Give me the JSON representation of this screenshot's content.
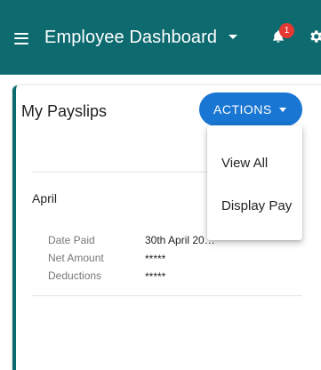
{
  "appbar": {
    "title": "Employee Dashboard",
    "notification_count": "1",
    "background": "#0d6a6f"
  },
  "card": {
    "title": "My Payslips",
    "actions_label": "ACTIONS",
    "accent": "#0d6a6f",
    "button_color": "#1976d2"
  },
  "menu": {
    "items": [
      "View All",
      "Display Pay"
    ]
  },
  "payslip": {
    "month": "April",
    "rows": [
      {
        "label": "Date Paid",
        "value": "30th April 20…"
      },
      {
        "label": "Net Amount",
        "value": "*****"
      },
      {
        "label": "Deductions",
        "value": "*****"
      }
    ]
  },
  "icons": {
    "menu": "hamburger-icon",
    "dropdown": "chevron-down-icon",
    "notifications": "bell-icon",
    "settings": "gear-icon"
  }
}
